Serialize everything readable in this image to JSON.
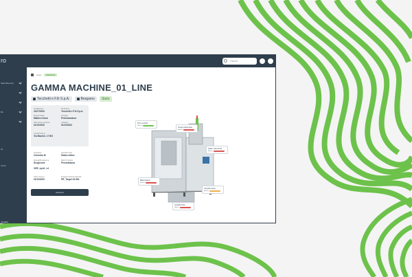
{
  "colors": {
    "accent_green": "#6dc24b",
    "dark_navy": "#2e3e4c",
    "red_status": "#d9534f",
    "orange_status": "#f0ad4e",
    "light_green": "#c8e8c0"
  },
  "brand": "ro",
  "search": {
    "placeholder": "Cerca"
  },
  "sidebar": {
    "items": [
      {
        "label": "Sala Ricevuta",
        "icon": "chevron-down-icon"
      },
      {
        "label": "",
        "icon": "chevron-down-icon"
      },
      {
        "label": "",
        "icon": "chevron-down-icon"
      },
      {
        "label": "Bo",
        "icon": "chevron-down-icon"
      },
      {
        "label": "",
        "icon": "chevron-down-icon"
      },
      {
        "label": "de",
        "icon": "none"
      },
      {
        "label": "menti",
        "icon": "none"
      },
      {
        "label": "",
        "icon": "none"
      }
    ],
    "footer": "om"
  },
  "breadcrumb": [
    "Linee",
    "Macchina"
  ],
  "page": {
    "title": "GAMMA MACHINE_01_LINE"
  },
  "tags": [
    {
      "label": "Tecchetti e F.lli S.p.A.",
      "icon": "user-icon"
    },
    {
      "label": "Bergamo",
      "icon": "location-icon"
    },
    {
      "label": "Stato",
      "icon": "none"
    }
  ],
  "info": [
    {
      "label": "Installazione",
      "value": "21/07/2023"
    },
    {
      "label": "Produttore",
      "value": "Tecchetti e F.lli S.p.A."
    },
    {
      "label": "Responsabile",
      "value": "Mattero Sossi"
    },
    {
      "label": "Famiglia",
      "value": "Proiezionatura"
    },
    {
      "label": "Data ultima gestione",
      "value": "01/10/2023"
    },
    {
      "label": "Collaudo",
      "value": "01/10/2023"
    },
    {
      "label": "Localizzazione",
      "value": "Via Mazzini, 17 BG"
    }
  ],
  "details": [
    {
      "label": "Operatore",
      "value": "Colombo M."
    },
    {
      "label": "Operatore Mo",
      "value": "Status Attivo"
    },
    {
      "label": "Ricetta/Programma",
      "value": "Dregheone"
    },
    {
      "label": "Batch Prodotto",
      "value": "Prezzettatura"
    },
    {
      "label": "",
      "value": "OEE_syst1_v4"
    },
    {
      "label": "",
      "value": ""
    },
    {
      "label": "Ultimo Fermo",
      "value": "01/10/2023"
    },
    {
      "label": "Programmazione Mensile",
      "value": "PR_Target 23.954"
    }
  ],
  "action_button": "Gestione",
  "callouts": [
    {
      "label": "Film vertical",
      "status": "Allarme"
    },
    {
      "label": "Gruppi alimentat.",
      "status": "Allarme"
    },
    {
      "label": "Saldi. trasversal",
      "status": "Allarme"
    },
    {
      "label": "Bilanciatura",
      "status": "Allarme"
    },
    {
      "label": "Cinghia trasp.",
      "status": "Allarme"
    },
    {
      "label": "Cinghia Prim...",
      "status": "Allarme"
    }
  ]
}
